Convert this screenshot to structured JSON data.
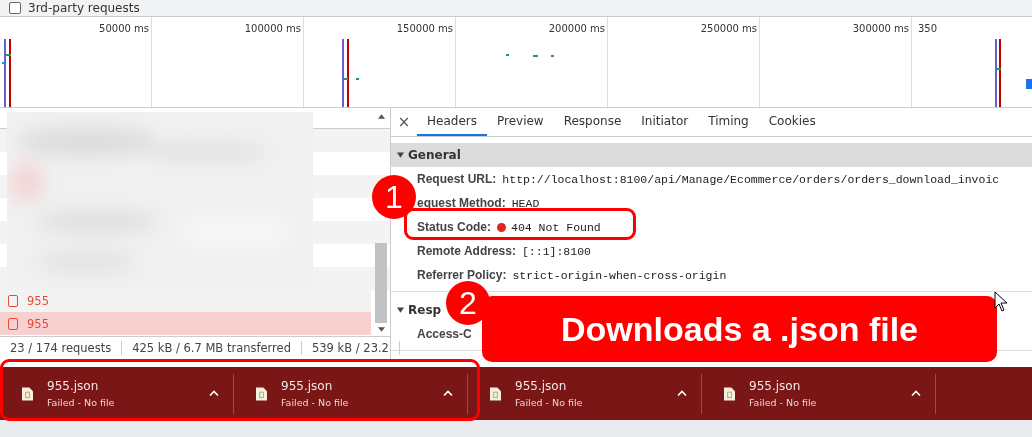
{
  "filter": {
    "label": "3rd-party requests",
    "checked": false
  },
  "overview": {
    "ticks": [
      "50000 ms",
      "100000 ms",
      "150000 ms",
      "200000 ms",
      "250000 ms",
      "300000 ms",
      "350"
    ]
  },
  "requests": {
    "rows": [
      {
        "name": "955",
        "selected": false
      },
      {
        "name": "955",
        "selected": true
      }
    ]
  },
  "status_bar": [
    "23 / 174 requests",
    "425 kB / 6.7 MB transferred",
    "539 kB / 23.2"
  ],
  "details": {
    "close": "×",
    "tabs": [
      {
        "label": "Headers",
        "selected": true
      },
      {
        "label": "Preview",
        "selected": false
      },
      {
        "label": "Response",
        "selected": false
      },
      {
        "label": "Initiator",
        "selected": false
      },
      {
        "label": "Timing",
        "selected": false
      },
      {
        "label": "Cookies",
        "selected": false
      }
    ],
    "sections": [
      {
        "title": "General",
        "expanded": true,
        "rows": [
          {
            "kind": "plain",
            "name": "Request URL:",
            "value": "http://localhost:8100/api/Manage/Ecommerce/orders/orders_download_invoic"
          },
          {
            "kind": "plain",
            "name": "equest Method:",
            "value": "HEAD"
          },
          {
            "kind": "status",
            "name": "Status Code:",
            "value": "404 Not Found",
            "color": "#e02424"
          },
          {
            "kind": "plain",
            "name": "Remote Address:",
            "value": "[::1]:8100"
          },
          {
            "kind": "plain",
            "name": "Referrer Policy:",
            "value": "strict-origin-when-cross-origin"
          }
        ]
      },
      {
        "title": "Resp",
        "expanded": true,
        "rows": [
          {
            "kind": "plain",
            "name": "Access-C",
            "value": ""
          }
        ]
      }
    ]
  },
  "downloads": [
    {
      "name": "955.json",
      "status": "Failed - No file"
    },
    {
      "name": "955.json",
      "status": "Failed - No file"
    },
    {
      "name": "955.json",
      "status": "Failed - No file"
    },
    {
      "name": "955.json",
      "status": "Failed - No file"
    }
  ],
  "annotations": [
    {
      "kind": "number",
      "text": "1"
    },
    {
      "kind": "number",
      "text": "2"
    },
    {
      "kind": "banner",
      "text": "Downloads a .json file"
    }
  ]
}
